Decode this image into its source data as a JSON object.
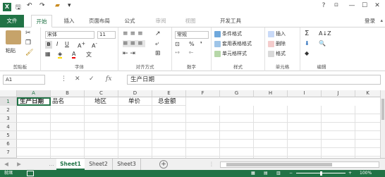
{
  "titlebar": {
    "help": "?",
    "window_controls": [
      "—",
      "☐",
      "✕"
    ]
  },
  "tabs": {
    "file": "文件",
    "items": [
      "开始",
      "插入",
      "页面布局",
      "公式",
      "审阅",
      "视图",
      "开发工具"
    ],
    "login": "登录"
  },
  "ribbon": {
    "clipboard": {
      "paste": "粘贴",
      "label": "剪贴板"
    },
    "font": {
      "name": "宋体",
      "size": "11",
      "label": "字体"
    },
    "alignment": {
      "label": "对齐方式"
    },
    "number": {
      "format": "常规",
      "label": "数字",
      "percent": "%"
    },
    "styles": {
      "conditional": "条件格式",
      "table": "套用表格格式",
      "cell": "单元格样式",
      "label": "样式"
    },
    "cells": {
      "insert": "插入",
      "delete": "删除",
      "format": "格式",
      "label": "单元格"
    },
    "editing": {
      "label": "编辑"
    }
  },
  "formula_bar": {
    "name_box": "A1",
    "fx": "fx",
    "content": "生产日期"
  },
  "grid": {
    "columns": [
      "A",
      "B",
      "C",
      "D",
      "E",
      "F",
      "G",
      "H",
      "I",
      "J",
      "K"
    ],
    "rows": [
      "1",
      "2",
      "3",
      "4",
      "5",
      "6",
      "7"
    ],
    "row1": [
      "生产日期",
      "品名",
      "地区",
      "单价",
      "总金额"
    ]
  },
  "sheets": {
    "tabs": [
      "Sheet1",
      "Sheet2",
      "Sheet3"
    ],
    "active": "Sheet1",
    "add": "+"
  },
  "status": {
    "mode": "就绪",
    "zoom": "100%"
  },
  "colors": {
    "excel_green": "#217346"
  }
}
